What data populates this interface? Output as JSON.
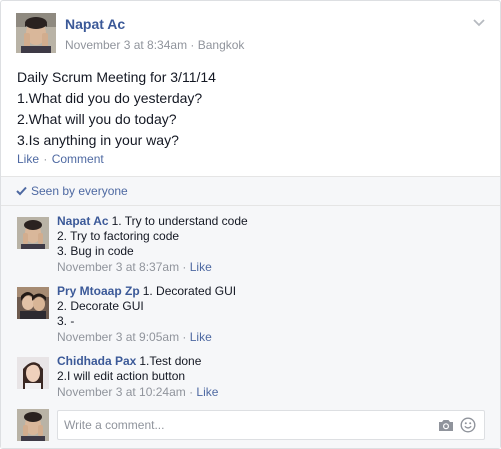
{
  "post": {
    "author": "Napat Ac",
    "timestamp": "November 3 at 8:34am",
    "meta_separator": " · ",
    "location": "Bangkok",
    "lines": [
      "Daily Scrum Meeting for 3/11/14",
      "1.What did you do yesterday?",
      "2.What will you do today?",
      "3.Is anything in your way?"
    ],
    "actions": {
      "like": "Like",
      "separator": " · ",
      "comment": "Comment"
    }
  },
  "seen_by": "Seen by everyone",
  "comments": [
    {
      "author": "Napat Ac",
      "lines": [
        "1. Try to understand code",
        "2. Try to factoring code",
        "3. Bug in code"
      ],
      "timestamp": "November 3 at 8:37am",
      "separator": " · ",
      "like": "Like"
    },
    {
      "author": "Pry Mtoaap Zp",
      "lines": [
        "1. Decorated GUI",
        "2. Decorate GUI",
        "3. -"
      ],
      "timestamp": "November 3 at 9:05am",
      "separator": " · ",
      "like": "Like"
    },
    {
      "author": "Chidhada Pax",
      "lines": [
        "1.Test done",
        "2.I will edit action button"
      ],
      "timestamp": "November 3 at 10:24am",
      "separator": " · ",
      "like": "Like"
    }
  ],
  "composer": {
    "placeholder": "Write a comment..."
  },
  "colors": {
    "link": "#3b5998",
    "link_secondary": "#4e69a2",
    "meta_grey": "#90949c",
    "feedback_bg": "#f6f7f9",
    "border": "#dddfe2"
  },
  "icons": {
    "post_menu": "chevron-down-icon",
    "seen": "checkmark-icon",
    "camera": "camera-icon",
    "emoji": "smiley-icon"
  }
}
